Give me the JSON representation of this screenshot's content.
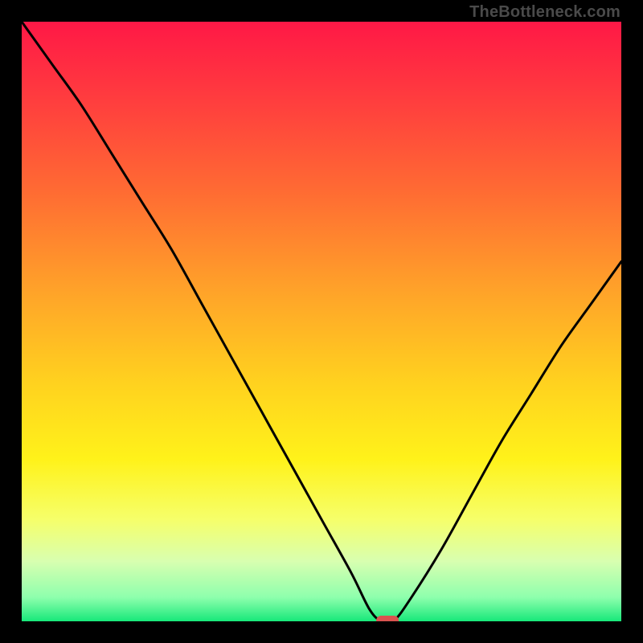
{
  "watermark": "TheBottleneck.com",
  "chart_data": {
    "type": "line",
    "title": "",
    "xlabel": "",
    "ylabel": "",
    "xlim": [
      0,
      100
    ],
    "ylim": [
      0,
      100
    ],
    "grid": false,
    "series": [
      {
        "name": "curve",
        "x": [
          0,
          5,
          10,
          15,
          20,
          25,
          30,
          35,
          40,
          45,
          50,
          55,
          58,
          60,
          62,
          65,
          70,
          75,
          80,
          85,
          90,
          95,
          100
        ],
        "values": [
          100,
          93,
          86,
          78,
          70,
          62,
          53,
          44,
          35,
          26,
          17,
          8,
          2,
          0,
          0,
          4,
          12,
          21,
          30,
          38,
          46,
          53,
          60
        ]
      }
    ],
    "marker": {
      "x": 61,
      "y": 0,
      "color": "#d9534f"
    },
    "gradient_stops_pct_from_top": [
      {
        "pct": 0,
        "color": "#ff1846"
      },
      {
        "pct": 12,
        "color": "#ff3a3f"
      },
      {
        "pct": 28,
        "color": "#ff6a33"
      },
      {
        "pct": 45,
        "color": "#ffa329"
      },
      {
        "pct": 60,
        "color": "#ffd11f"
      },
      {
        "pct": 73,
        "color": "#fff21a"
      },
      {
        "pct": 83,
        "color": "#f6ff6a"
      },
      {
        "pct": 90,
        "color": "#d8ffb0"
      },
      {
        "pct": 96,
        "color": "#8effad"
      },
      {
        "pct": 100,
        "color": "#17e87a"
      }
    ]
  }
}
